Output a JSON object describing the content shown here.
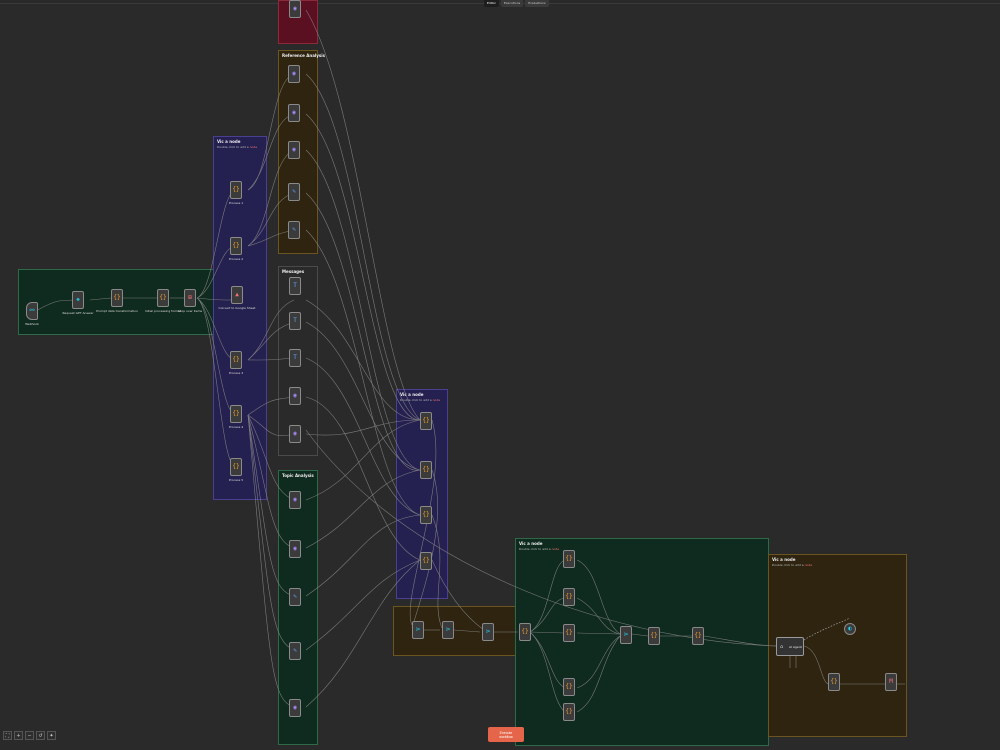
{
  "tabs": [
    "Editor",
    "Executions",
    "Evaluations"
  ],
  "colors": {
    "canvas": "#2a2a2a",
    "green_group": "#0f2a1e",
    "purple_group": "#24204f",
    "brown_group": "#2e2410",
    "red_group": "#5a1020",
    "accent": "#e5654a",
    "warning": "#f87171"
  },
  "groups": {
    "trigger": {
      "title": "",
      "sub": ""
    },
    "red": {
      "title": "",
      "sub": ""
    },
    "brown_top": {
      "title": "Reference Analysis",
      "sub": ""
    },
    "purple_left": {
      "title": "Vic a node",
      "sub_before": "Double click to add a ",
      "sub_warn": "node"
    },
    "gray_mid": {
      "title": "Messages",
      "sub": ""
    },
    "green_left": {
      "title": "Topic Analysis",
      "sub": ""
    },
    "purple_mid": {
      "title": "Vic a node",
      "sub_before": "Double click to add a ",
      "sub_warn": "node"
    },
    "brown_bottom": {
      "title": "",
      "sub": ""
    },
    "green_right": {
      "title": "Vic a node",
      "sub_before": "Double click to add a ",
      "sub_warn": "node"
    },
    "brown_right": {
      "title": "Vic a node",
      "sub_before": "Double click to add a ",
      "sub_warn": "node"
    }
  },
  "nodes": [
    {
      "id": "n1",
      "label": "Webhook",
      "sub": "",
      "icon": "webhook-icon",
      "glyph": "⚯",
      "kind": "g-merge"
    },
    {
      "id": "n2",
      "label": "Request GPT Answer",
      "sub": "",
      "icon": "http-icon",
      "glyph": "◈",
      "kind": "g-merge"
    },
    {
      "id": "n3",
      "label": "Prompt data transformation",
      "sub": "",
      "icon": "code-icon",
      "glyph": "{}",
      "kind": "g-code"
    },
    {
      "id": "n4",
      "label": "Initial processing format",
      "sub": "",
      "icon": "code-icon",
      "glyph": "{}",
      "kind": "g-code"
    },
    {
      "id": "n5",
      "label": "Loop over items",
      "sub": "",
      "icon": "loop-icon",
      "glyph": "⊞",
      "kind": "g-ext"
    },
    {
      "id": "n6",
      "label": "Convert to Google Sheet",
      "sub": "",
      "icon": "sheet-icon",
      "glyph": "▲",
      "kind": "g-ext"
    },
    {
      "id": "n7",
      "label": "Process 1",
      "sub": "",
      "icon": "code-icon",
      "glyph": "{}",
      "kind": "g-code"
    },
    {
      "id": "n8",
      "label": "Process 2",
      "sub": "",
      "icon": "code-icon",
      "glyph": "{}",
      "kind": "g-code"
    },
    {
      "id": "n9",
      "label": "Process 3",
      "sub": "",
      "icon": "code-icon",
      "glyph": "{}",
      "kind": "g-code"
    },
    {
      "id": "n10",
      "label": "Process 4",
      "sub": "",
      "icon": "code-icon",
      "glyph": "{}",
      "kind": "g-code"
    },
    {
      "id": "n11",
      "label": "Process 5",
      "sub": "",
      "icon": "code-icon",
      "glyph": "{}",
      "kind": "g-code"
    },
    {
      "id": "n12",
      "label": "",
      "sub": "",
      "icon": "ai-icon",
      "glyph": "◉",
      "kind": "g-ai"
    },
    {
      "id": "n13",
      "label": "",
      "sub": "",
      "icon": "ai-icon",
      "glyph": "◉",
      "kind": "g-ai"
    },
    {
      "id": "n14",
      "label": "",
      "sub": "",
      "icon": "ai-icon",
      "glyph": "◉",
      "kind": "g-ai"
    },
    {
      "id": "n15",
      "label": "",
      "sub": "",
      "icon": "ai-icon",
      "glyph": "◉",
      "kind": "g-ai"
    },
    {
      "id": "n16",
      "label": "",
      "sub": "",
      "icon": "http-icon",
      "glyph": "✎",
      "kind": "g-http"
    },
    {
      "id": "n17",
      "label": "",
      "sub": "",
      "icon": "http-icon",
      "glyph": "✎",
      "kind": "g-http"
    },
    {
      "id": "n18",
      "label": "",
      "sub": "",
      "icon": "text-icon",
      "glyph": "T",
      "kind": "g-http"
    },
    {
      "id": "n19",
      "label": "",
      "sub": "",
      "icon": "text-icon",
      "glyph": "T",
      "kind": "g-http"
    },
    {
      "id": "n20",
      "label": "",
      "sub": "",
      "icon": "text-icon",
      "glyph": "T",
      "kind": "g-http"
    },
    {
      "id": "n21",
      "label": "",
      "sub": "",
      "icon": "text-icon",
      "glyph": "T",
      "kind": "g-http"
    },
    {
      "id": "n22",
      "label": "",
      "sub": "",
      "icon": "ai-icon",
      "glyph": "◉",
      "kind": "g-ai"
    },
    {
      "id": "n23",
      "label": "",
      "sub": "",
      "icon": "ai-icon",
      "glyph": "◉",
      "kind": "g-ai"
    },
    {
      "id": "n24",
      "label": "",
      "sub": "",
      "icon": "ai-icon",
      "glyph": "◉",
      "kind": "g-ai"
    },
    {
      "id": "n25",
      "label": "",
      "sub": "",
      "icon": "ai-icon",
      "glyph": "◉",
      "kind": "g-ai"
    },
    {
      "id": "n26",
      "label": "",
      "sub": "",
      "icon": "text-icon",
      "glyph": "✎",
      "kind": "g-http"
    },
    {
      "id": "n27",
      "label": "",
      "sub": "",
      "icon": "text-icon",
      "glyph": "✎",
      "kind": "g-http"
    },
    {
      "id": "n28",
      "label": "",
      "sub": "",
      "icon": "ai-icon",
      "glyph": "◉",
      "kind": "g-ai"
    },
    {
      "id": "n29",
      "label": "",
      "sub": "",
      "icon": "code-icon",
      "glyph": "{}",
      "kind": "g-code"
    },
    {
      "id": "n30",
      "label": "",
      "sub": "",
      "icon": "code-icon",
      "glyph": "{}",
      "kind": "g-code"
    },
    {
      "id": "n31",
      "label": "",
      "sub": "",
      "icon": "code-icon",
      "glyph": "{}",
      "kind": "g-code"
    },
    {
      "id": "n32",
      "label": "",
      "sub": "",
      "icon": "code-icon",
      "glyph": "{}",
      "kind": "g-code"
    },
    {
      "id": "n33",
      "label": "",
      "sub": "",
      "icon": "merge-icon",
      "glyph": "⋗",
      "kind": "g-merge"
    },
    {
      "id": "n34",
      "label": "",
      "sub": "",
      "icon": "merge-icon",
      "glyph": "⋗",
      "kind": "g-merge"
    },
    {
      "id": "n35",
      "label": "",
      "sub": "",
      "icon": "merge-icon",
      "glyph": "⋗",
      "kind": "g-merge"
    },
    {
      "id": "n36",
      "label": "",
      "sub": "",
      "icon": "code-icon",
      "glyph": "{}",
      "kind": "g-code"
    },
    {
      "id": "n37",
      "label": "",
      "sub": "",
      "icon": "code-icon",
      "glyph": "{}",
      "kind": "g-code"
    },
    {
      "id": "n38",
      "label": "",
      "sub": "",
      "icon": "code-icon",
      "glyph": "{}",
      "kind": "g-code"
    },
    {
      "id": "n39",
      "label": "",
      "sub": "",
      "icon": "code-icon",
      "glyph": "{}",
      "kind": "g-code"
    },
    {
      "id": "n40",
      "label": "",
      "sub": "",
      "icon": "code-icon",
      "glyph": "{}",
      "kind": "g-code"
    },
    {
      "id": "n41",
      "label": "",
      "sub": "",
      "icon": "code-icon",
      "glyph": "{}",
      "kind": "g-code"
    },
    {
      "id": "n42",
      "label": "",
      "sub": "",
      "icon": "merge-icon",
      "glyph": "⋗",
      "kind": "g-merge"
    },
    {
      "id": "n43",
      "label": "",
      "sub": "",
      "icon": "code-icon",
      "glyph": "{}",
      "kind": "g-code"
    },
    {
      "id": "n44",
      "label": "",
      "sub": "",
      "icon": "code-icon",
      "glyph": "{}",
      "kind": "g-code"
    },
    {
      "id": "n45",
      "label": "",
      "sub": "",
      "icon": "code-icon",
      "glyph": "{}",
      "kind": "g-code"
    },
    {
      "id": "n46",
      "label": "",
      "sub": "",
      "icon": "gmail-icon",
      "glyph": "M",
      "kind": "g-ext"
    },
    {
      "id": "n47",
      "label": "",
      "sub": "",
      "icon": "openai-icon",
      "glyph": "◐",
      "kind": "g-merge"
    }
  ],
  "webhook_response": {
    "label": "AI Agent",
    "icon": "robot-icon"
  },
  "execute_button": "Execute workflow",
  "zoom_controls": [
    {
      "icon": "fit-view-icon",
      "glyph": "⛶"
    },
    {
      "icon": "zoom-in-icon",
      "glyph": "+"
    },
    {
      "icon": "zoom-out-icon",
      "glyph": "−"
    },
    {
      "icon": "reset-zoom-icon",
      "glyph": "↺"
    },
    {
      "icon": "tidy-up-icon",
      "glyph": "✦"
    }
  ]
}
